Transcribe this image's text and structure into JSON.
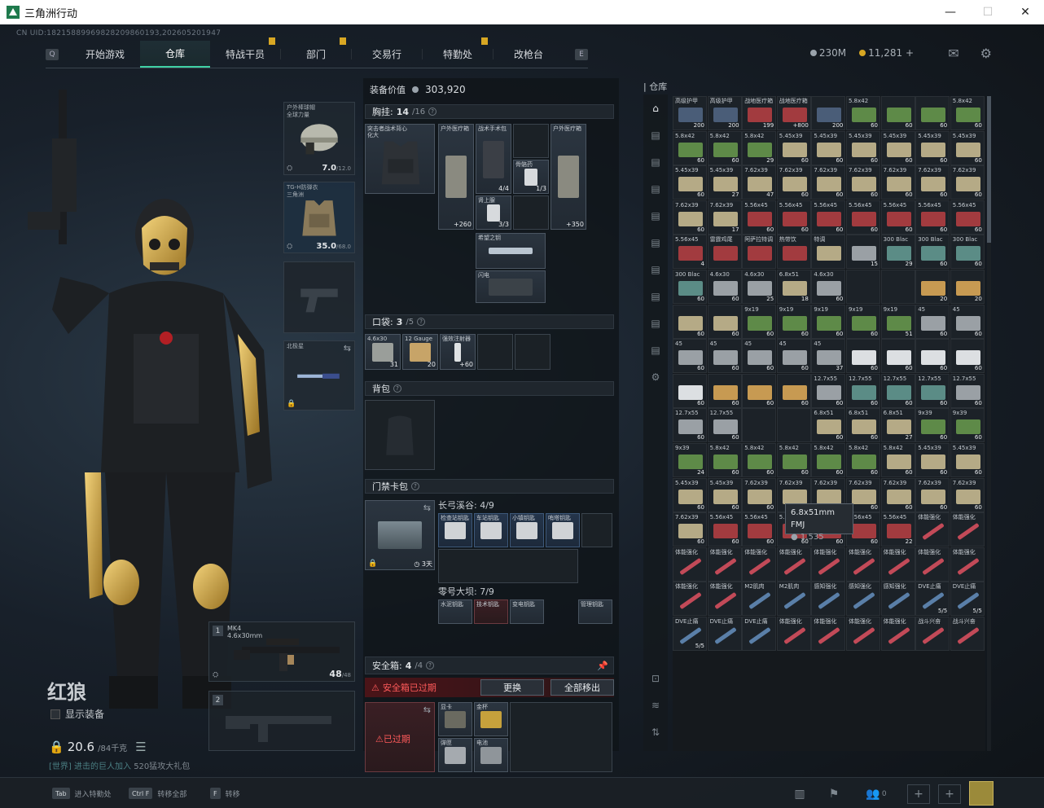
{
  "window": {
    "title": "三角洲行动",
    "min": "—",
    "max": "☐",
    "close": "✕"
  },
  "uid": "CN UID:18215889969828209860193,202605201947",
  "nav": {
    "left_key": "Q",
    "right_key": "E",
    "tabs": [
      "开始游戏",
      "仓库",
      "特战干员",
      "部门",
      "交易行",
      "特勤处",
      "改枪台"
    ],
    "active": 1
  },
  "currency": {
    "silver": "230M",
    "gold": "11,281",
    "gold_plus": "+"
  },
  "character": {
    "name": "红狼",
    "show_equip": "显示装备",
    "weight": "20.6",
    "weight_max": "/84千克",
    "chat_channel": "[世界]",
    "chat_text": "进击的巨人加入",
    "chat_tail": "520猛攻大礼包"
  },
  "equip": {
    "helmet": {
      "label": "户外棒球帽\n全球力量",
      "dur": "7.0",
      "dur_max": "/12.0"
    },
    "armor": {
      "label": "TG-H防弹衣\n三角洲",
      "dur": "35.0",
      "dur_max": "/68.0"
    },
    "melee": {
      "label": "北极星"
    }
  },
  "weapons": [
    {
      "num": "1",
      "name": "MK4\n4.6x30mm",
      "ammo": "48",
      "ammo_max": "/48"
    },
    {
      "num": "2",
      "name": "",
      "ammo": "",
      "ammo_max": ""
    }
  ],
  "panel": {
    "value_label": "装备价值",
    "value": "303,920",
    "chest_title": "胸挂:",
    "chest_count": "14",
    "chest_max": "/16",
    "chest_items": [
      {
        "name": "突击者战术背心\n化大",
        "qty": ""
      },
      {
        "name": "户外医疗箱",
        "qty": "+260"
      },
      {
        "name": "战术手术包",
        "qty": "4/4"
      },
      {
        "name": "骨骼药",
        "qty": "1/3"
      },
      {
        "name": "户外医疗箱",
        "qty": "+350"
      },
      {
        "name": "肾上腺",
        "qty": "3/3"
      },
      {
        "name": "希望之钥",
        "qty": ""
      },
      {
        "name": "闪电",
        "qty": ""
      }
    ],
    "pocket_title": "口袋:",
    "pocket_count": "3",
    "pocket_max": "/5",
    "pocket_items": [
      {
        "name": "4.6x30",
        "qty": "31"
      },
      {
        "name": "12 Gauge",
        "qty": "20"
      },
      {
        "name": "强效注射器",
        "qty": "+60"
      }
    ],
    "backpack_title": "背包",
    "keycase_title": "门禁卡包",
    "keycase_days": "3天",
    "key_group1": "长弓溪谷: 4/9",
    "key_group1_items": [
      "检查站钥匙",
      "车站钥匙",
      "小镇钥匙",
      "哨塔钥匙"
    ],
    "key_group2": "零号大坝: 7/9",
    "key_group2_items": [
      "水泥钥匙",
      "技术钥匙",
      "变电钥匙",
      "管理钥匙"
    ],
    "safe_title": "安全箱:",
    "safe_count": "4",
    "safe_max": "/4",
    "safe_warn": "安全箱已过期",
    "btn_replace": "更换",
    "btn_remove_all": "全部移出",
    "safe_expired": "已过期",
    "safe_items": [
      "显卡",
      "金杯",
      "弹匣",
      "电池"
    ]
  },
  "stash": {
    "title": "仓库",
    "tooltip_name": "6.8x51mm FMJ",
    "tooltip_price": "1,535",
    "cells": [
      [
        "高级护甲",
        "200",
        "blue"
      ],
      [
        "高级护甲",
        "200",
        "blue"
      ],
      [
        "战地医疗箱",
        "199",
        "red"
      ],
      [
        "战地医疗箱",
        "+800",
        "red"
      ],
      [
        "",
        "200",
        "blue"
      ],
      [
        "5.8x42",
        "60",
        "green"
      ],
      [
        "",
        "60",
        "green"
      ],
      [
        "",
        "60",
        "green"
      ],
      [
        "5.8x42",
        "60",
        "green"
      ],
      [
        "5.8x42",
        "60",
        "green"
      ],
      [
        "5.8x42",
        "60",
        "green"
      ],
      [
        "5.8x42",
        "29",
        "green"
      ],
      [
        "5.45x39",
        "60",
        "tan"
      ],
      [
        "5.45x39",
        "60",
        "tan"
      ],
      [
        "5.45x39",
        "60",
        "tan"
      ],
      [
        "5.45x39",
        "60",
        "tan"
      ],
      [
        "5.45x39",
        "60",
        "tan"
      ],
      [
        "5.45x39",
        "60",
        "tan"
      ],
      [
        "5.45x39",
        "60",
        "tan"
      ],
      [
        "5.45x39",
        "27",
        "tan"
      ],
      [
        "7.62x39",
        "47",
        "tan"
      ],
      [
        "7.62x39",
        "60",
        "tan"
      ],
      [
        "7.62x39",
        "60",
        "tan"
      ],
      [
        "7.62x39",
        "60",
        "tan"
      ],
      [
        "7.62x39",
        "60",
        "tan"
      ],
      [
        "7.62x39",
        "60",
        "tan"
      ],
      [
        "7.62x39",
        "60",
        "tan"
      ],
      [
        "7.62x39",
        "60",
        "tan"
      ],
      [
        "7.62x39",
        "17",
        "tan"
      ],
      [
        "5.56x45",
        "60",
        "red"
      ],
      [
        "5.56x45",
        "60",
        "red"
      ],
      [
        "5.56x45",
        "60",
        "red"
      ],
      [
        "5.56x45",
        "60",
        "red"
      ],
      [
        "5.56x45",
        "60",
        "red"
      ],
      [
        "5.56x45",
        "60",
        "red"
      ],
      [
        "5.56x45",
        "60",
        "red"
      ],
      [
        "5.56x45",
        "4",
        "red"
      ],
      [
        "雷霆鸡尾",
        "",
        "red"
      ],
      [
        "阿萨拉特调",
        "",
        "red"
      ],
      [
        "热带饮",
        "",
        "red"
      ],
      [
        "特调",
        "",
        "tan"
      ],
      [
        "",
        "15",
        "gray"
      ],
      [
        "300 Blac",
        "29",
        "teal"
      ],
      [
        "300 Blac",
        "60",
        "teal"
      ],
      [
        "300 Blac",
        "60",
        "teal"
      ],
      [
        "300 Blac",
        "60",
        "teal"
      ],
      [
        "4.6x30",
        "60",
        "gray"
      ],
      [
        "4.6x30",
        "25",
        "gray"
      ],
      [
        "6.8x51",
        "18",
        "tan"
      ],
      [
        "4.6x30",
        "60",
        "gray"
      ],
      [
        "",
        "",
        "empty"
      ],
      [
        "",
        "",
        "empty"
      ],
      [
        "",
        "20",
        "box"
      ],
      [
        "",
        "20",
        "box"
      ],
      [
        "",
        "60",
        "tan"
      ],
      [
        "",
        "60",
        "tan"
      ],
      [
        "9x19",
        "60",
        "green"
      ],
      [
        "9x19",
        "60",
        "green"
      ],
      [
        "9x19",
        "60",
        "green"
      ],
      [
        "9x19",
        "60",
        "green"
      ],
      [
        "9x19",
        "51",
        "green"
      ],
      [
        "45",
        "60",
        "gray"
      ],
      [
        "45",
        "60",
        "gray"
      ],
      [
        "45",
        "60",
        "gray"
      ],
      [
        "45",
        "60",
        "gray"
      ],
      [
        "45",
        "60",
        "gray"
      ],
      [
        "45",
        "60",
        "gray"
      ],
      [
        "45",
        "37",
        "gray"
      ],
      [
        "",
        "60",
        "white"
      ],
      [
        "",
        "60",
        "white"
      ],
      [
        "",
        "60",
        "white"
      ],
      [
        "",
        "60",
        "white"
      ],
      [
        "",
        "60",
        "white"
      ],
      [
        "",
        "60",
        "box"
      ],
      [
        "",
        "60",
        "box"
      ],
      [
        "",
        "60",
        "box"
      ],
      [
        "12.7x55",
        "60",
        "gray"
      ],
      [
        "12.7x55",
        "60",
        "teal"
      ],
      [
        "12.7x55",
        "60",
        "teal"
      ],
      [
        "12.7x55",
        "60",
        "teal"
      ],
      [
        "12.7x55",
        "60",
        "gray"
      ],
      [
        "12.7x55",
        "60",
        "gray"
      ],
      [
        "12.7x55",
        "60",
        "gray"
      ],
      [
        "",
        "",
        "empty"
      ],
      [
        "",
        "",
        "empty"
      ],
      [
        "6.8x51",
        "60",
        "tan"
      ],
      [
        "6.8x51",
        "60",
        "tan"
      ],
      [
        "6.8x51",
        "27",
        "tan"
      ],
      [
        "9x39",
        "60",
        "green"
      ],
      [
        "9x39",
        "60",
        "green"
      ],
      [
        "9x39",
        "24",
        "green"
      ],
      [
        "5.8x42",
        "60",
        "green"
      ],
      [
        "5.8x42",
        "60",
        "green"
      ],
      [
        "5.8x42",
        "60",
        "green"
      ],
      [
        "5.8x42",
        "60",
        "green"
      ],
      [
        "5.8x42",
        "60",
        "green"
      ],
      [
        "5.8x42",
        "60",
        "tan"
      ],
      [
        "5.45x39",
        "60",
        "tan"
      ],
      [
        "5.45x39",
        "60",
        "tan"
      ],
      [
        "5.45x39",
        "60",
        "tan"
      ],
      [
        "5.45x39",
        "60",
        "tan"
      ],
      [
        "7.62x39",
        "60",
        "tan"
      ],
      [
        "7.62x39",
        "60",
        "tan"
      ],
      [
        "7.62x39",
        "60",
        "tan"
      ],
      [
        "7.62x39",
        "60",
        "tan"
      ],
      [
        "7.62x39",
        "60",
        "tan"
      ],
      [
        "7.62x39",
        "60",
        "tan"
      ],
      [
        "7.62x39",
        "60",
        "tan"
      ],
      [
        "7.62x39",
        "60",
        "tan"
      ],
      [
        "5.56x45",
        "60",
        "red"
      ],
      [
        "5.56x45",
        "60",
        "red"
      ],
      [
        "5.56x45",
        "60",
        "red"
      ],
      [
        "5.56x45",
        "60",
        "red"
      ],
      [
        "5.56x45",
        "60",
        "red"
      ],
      [
        "5.56x45",
        "22",
        "red"
      ],
      [
        "体能强化",
        "",
        "syringe"
      ],
      [
        "体能强化",
        "",
        "syringe"
      ],
      [
        "体能强化",
        "",
        "syringe"
      ],
      [
        "体能强化",
        "",
        "syringe"
      ],
      [
        "体能强化",
        "",
        "syringe"
      ],
      [
        "体能强化",
        "",
        "syringe"
      ],
      [
        "体能强化",
        "",
        "syringe"
      ],
      [
        "体能强化",
        "",
        "syringe"
      ],
      [
        "体能强化",
        "",
        "syringe"
      ],
      [
        "体能强化",
        "",
        "syringe"
      ],
      [
        "体能强化",
        "",
        "syringe"
      ],
      [
        "体能强化",
        "",
        "syringe"
      ],
      [
        "体能强化",
        "",
        "syringe"
      ],
      [
        "M2肌肉",
        "",
        "syringeb"
      ],
      [
        "M2肌肉",
        "",
        "syringeb"
      ],
      [
        "感知强化",
        "",
        "syringeb"
      ],
      [
        "感知强化",
        "",
        "syringeb"
      ],
      [
        "感知强化",
        "",
        "syringeb"
      ],
      [
        "DVE止痛",
        "5/5",
        "syringeb"
      ],
      [
        "DVE止痛",
        "5/5",
        "syringeb"
      ],
      [
        "DVE止痛",
        "5/5",
        "syringeb"
      ],
      [
        "DVE止痛",
        "",
        "syringeb"
      ],
      [
        "DVE止痛",
        "",
        "syringeb"
      ],
      [
        "体能强化",
        "",
        "syringe"
      ],
      [
        "体能强化",
        "",
        "syringe"
      ],
      [
        "体能强化",
        "",
        "syringe"
      ],
      [
        "体能强化",
        "",
        "syringe"
      ],
      [
        "战斗兴奋",
        "",
        "syringe"
      ],
      [
        "战斗兴奋",
        "",
        "syringe"
      ]
    ]
  },
  "bottom": {
    "hints": [
      {
        "key": "Tab",
        "label": "进入特勤处"
      },
      {
        "key": "Ctrl F",
        "label": "转移全部"
      },
      {
        "key": "F",
        "label": "转移"
      }
    ],
    "friends": "0"
  }
}
